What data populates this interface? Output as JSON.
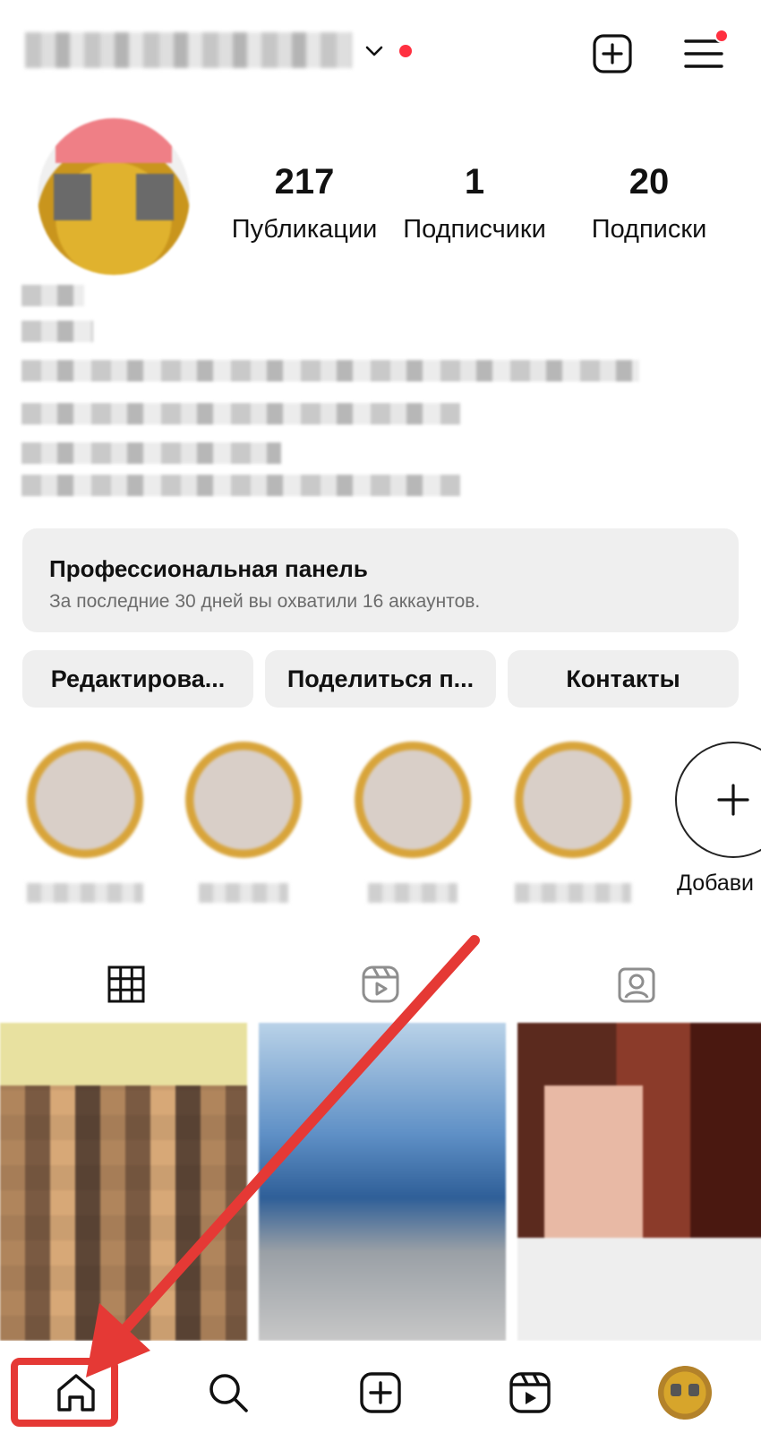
{
  "header": {
    "username_dropdown_icon": "chevron-down-icon",
    "notification_color": "#ff3040",
    "create_icon": "plus-square-icon",
    "menu_icon": "hamburger-menu-icon"
  },
  "profile": {
    "stats": [
      {
        "value": "217",
        "label": "Публикации"
      },
      {
        "value": "1",
        "label": "Подписчики"
      },
      {
        "value": "20",
        "label": "Подписки"
      }
    ]
  },
  "pro_panel": {
    "title": "Профессиональная панель",
    "subtitle": "За последние 30 дней вы охватили 16 аккаунтов."
  },
  "actions": {
    "edit": "Редактирова...",
    "share": "Поделиться п...",
    "contacts": "Контакты"
  },
  "highlights": {
    "add_label": "Добави"
  },
  "tabs": [
    "grid-icon",
    "reels-icon",
    "tagged-icon"
  ],
  "bottom_nav": [
    "home-icon",
    "search-icon",
    "create-icon",
    "reels-icon",
    "profile-avatar"
  ],
  "annotation": {
    "color": "#e53935"
  }
}
